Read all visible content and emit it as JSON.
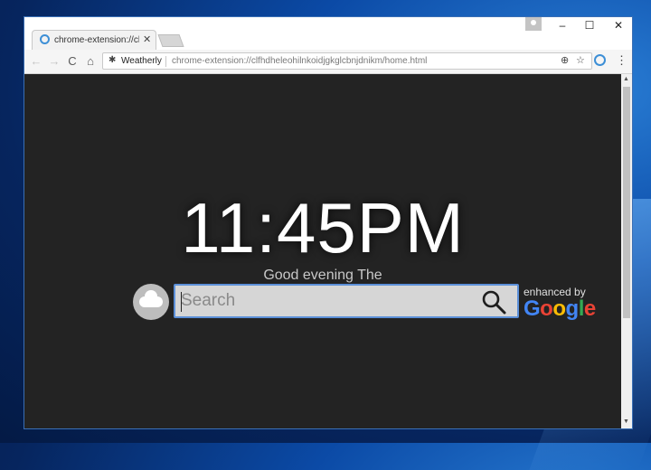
{
  "tab": {
    "title": "chrome-extension://clfhdheleohilnkoidjgkglcbnjdnikm",
    "close": "✕"
  },
  "window_controls": {
    "minimize": "–",
    "maximize": "☐",
    "close": "✕"
  },
  "toolbar": {
    "back": "←",
    "forward": "→",
    "reload": "C",
    "home": "⌂",
    "chip_label": "Weatherly",
    "url": "chrome-extension://clfhdheleohilnkoidjgkglcbnjdnikm/home.html",
    "menu": "⋮"
  },
  "page": {
    "time": "11:45PM",
    "greeting": "Good evening The",
    "search_placeholder": "Search",
    "enhanced_by": "enhanced by",
    "google_letters": [
      {
        "ch": "G",
        "color": "#4285F4"
      },
      {
        "ch": "o",
        "color": "#EA4335"
      },
      {
        "ch": "o",
        "color": "#FBBC05"
      },
      {
        "ch": "g",
        "color": "#4285F4"
      },
      {
        "ch": "l",
        "color": "#34A853"
      },
      {
        "ch": "e",
        "color": "#EA4335"
      }
    ]
  },
  "colors": {
    "content_bg": "#232323",
    "search_border": "#5b8fd8",
    "accent": "#3d8fd6"
  }
}
